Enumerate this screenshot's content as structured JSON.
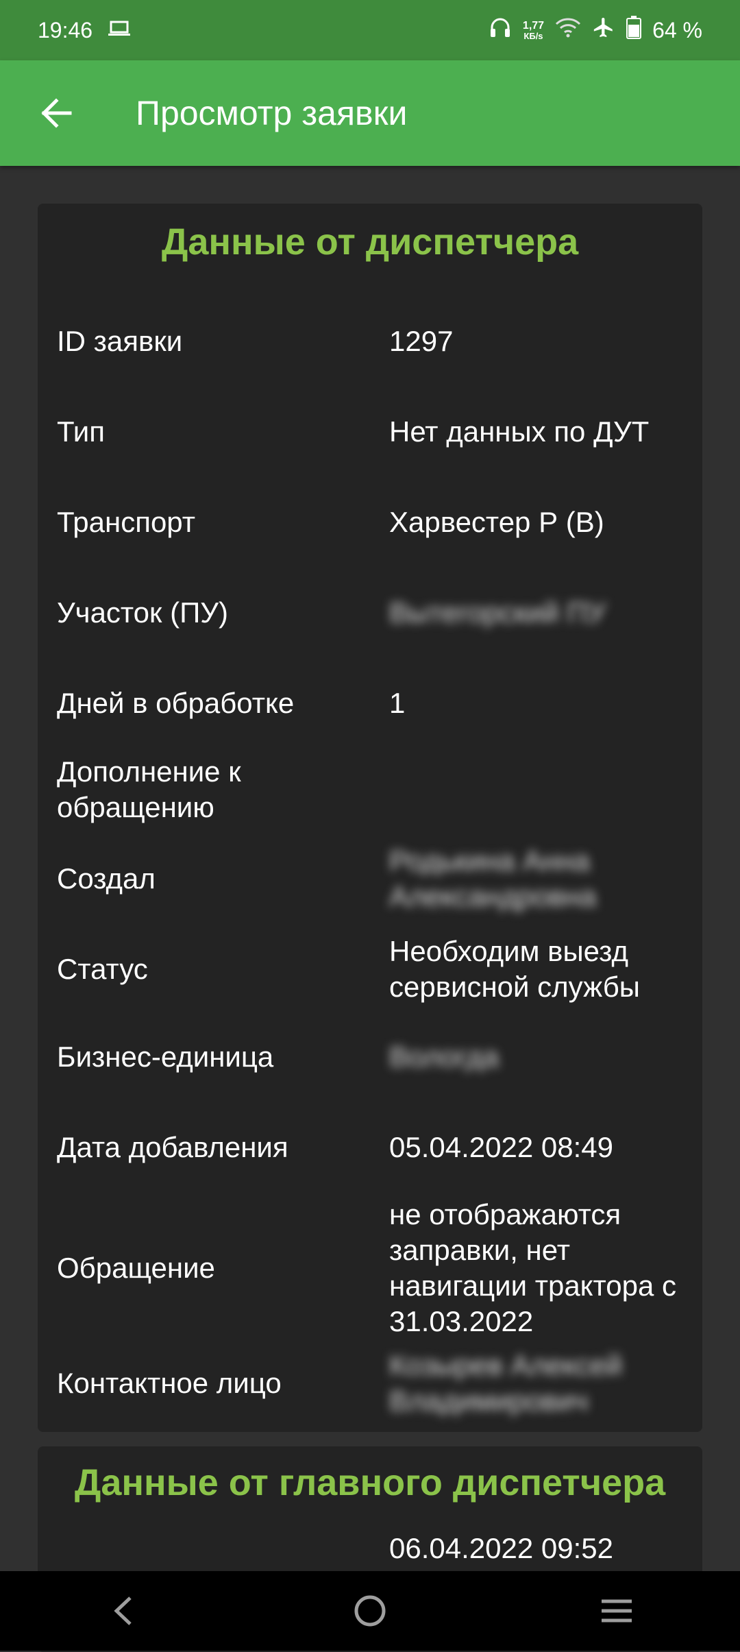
{
  "status_bar": {
    "time": "19:46",
    "speed_value": "1,77",
    "speed_unit": "КБ/s",
    "battery": "64 %",
    "icons": [
      "laptop-icon",
      "headphones-icon",
      "wifi-icon",
      "airplane-icon",
      "battery-icon"
    ]
  },
  "app_bar": {
    "title": "Просмотр заявки",
    "back_icon": "arrow-left-icon"
  },
  "dispatcher_card": {
    "title": "Данные от диспетчера",
    "rows": [
      {
        "label": "ID заявки",
        "value": "1297"
      },
      {
        "label": "Тип",
        "value": "Нет данных по ДУТ"
      },
      {
        "label": "Транспорт",
        "value": "Харвестер Р (В)"
      },
      {
        "label": "Участок (ПУ)",
        "value": "Вытегорский ПУ"
      },
      {
        "label": "Дней в обработке",
        "value": "1"
      },
      {
        "label": "Дополнение к обращению",
        "value": ""
      },
      {
        "label": "Создал",
        "value": "Родькина Анна Александровна"
      },
      {
        "label": "Статус",
        "value": "Необходим выезд сервисной службы"
      },
      {
        "label": "Бизнес-единица",
        "value": "Вологда"
      },
      {
        "label": "Дата добавления",
        "value": "05.04.2022 08:49"
      },
      {
        "label": "Обращение",
        "value": "не отображаются заправки, нет навигации трактора с 31.03.2022"
      },
      {
        "label": "Контактное лицо",
        "value": "Козырев Алексей Владимирович"
      }
    ]
  },
  "main_dispatcher_card": {
    "title": "Данные от главного диспетчера",
    "first_value": "06.04.2022 09:52"
  },
  "nav_bar": {
    "icons": [
      "back-icon",
      "home-icon",
      "menu-icon"
    ]
  },
  "colors": {
    "status_bar": "#3f8b3c",
    "app_bar": "#4caf50",
    "accent": "#8bc34a",
    "card": "#232323",
    "background": "#303030"
  }
}
